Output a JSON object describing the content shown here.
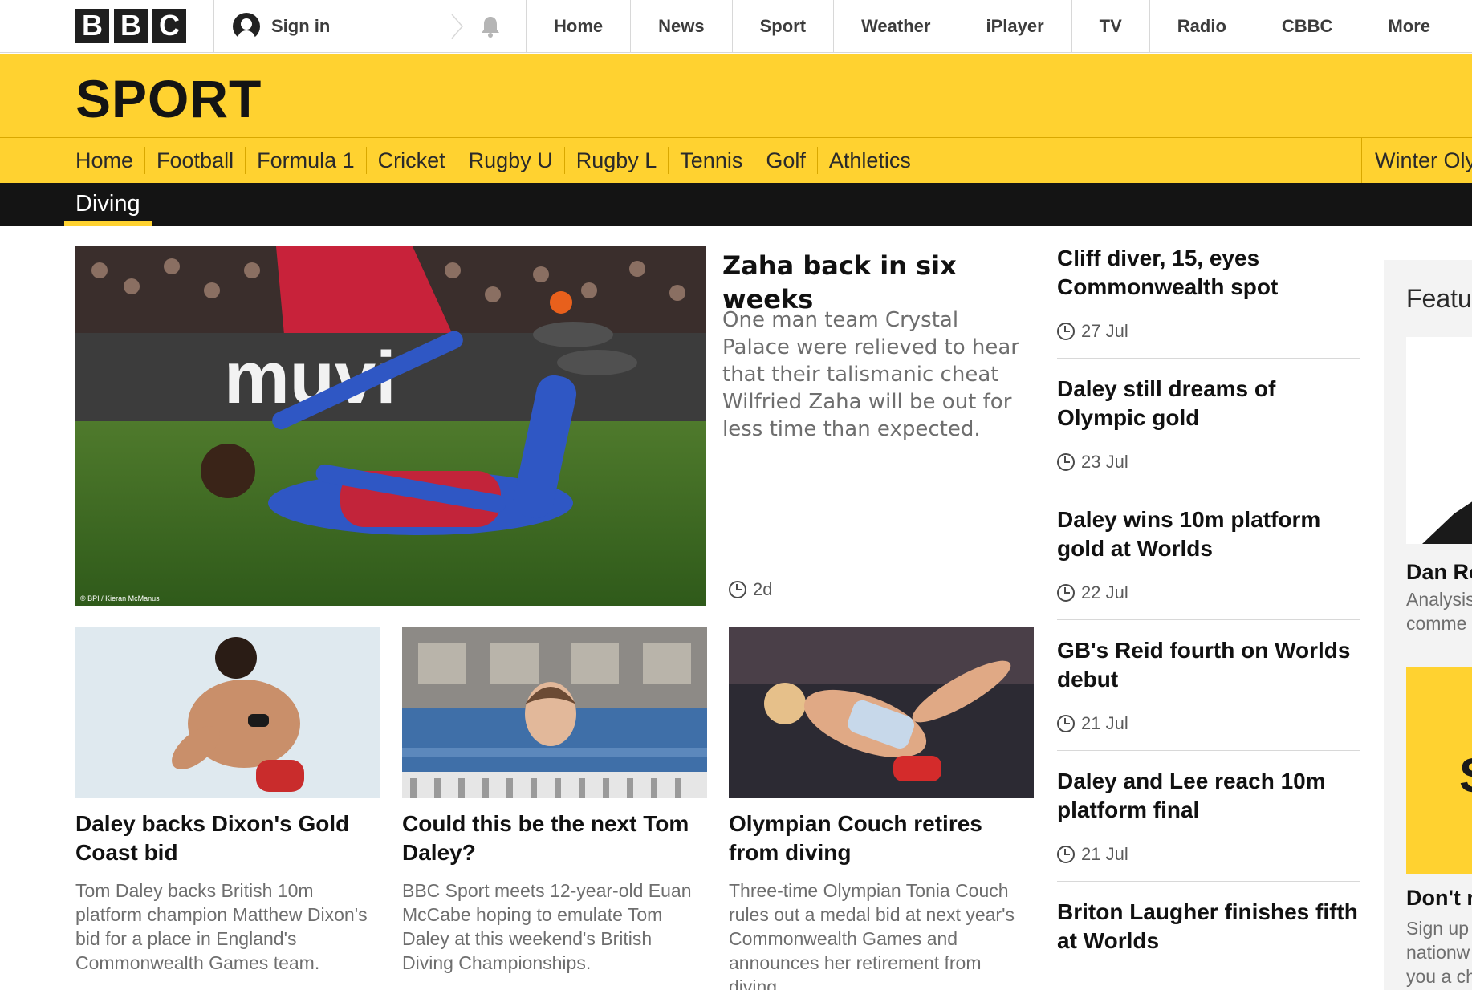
{
  "top_bar": {
    "logo_letters": [
      "B",
      "B",
      "C"
    ],
    "sign_in_label": "Sign in",
    "nav": [
      "Home",
      "News",
      "Sport",
      "Weather",
      "iPlayer",
      "TV",
      "Radio",
      "CBBC",
      "More"
    ]
  },
  "sport_header": {
    "title": "SPORT",
    "nav": [
      "Home",
      "Football",
      "Formula 1",
      "Cricket",
      "Rugby U",
      "Rugby L",
      "Tennis",
      "Golf",
      "Athletics"
    ],
    "overflow_item": "Winter Oly",
    "accent_color": "#ffd230"
  },
  "sub_nav": {
    "active_label": "Diving"
  },
  "lead_story": {
    "image_caption": "© BPI / Kieran McManus",
    "billboard_text": "muvi",
    "title": "Zaha back in six weeks",
    "summary": "One man team Crystal Palace were relieved to hear that their talismanic cheat Wilfried Zaha will be out for less time than expected.",
    "timestamp": "2d"
  },
  "cards": [
    {
      "title": "Daley backs Dixon's Gold Coast bid",
      "summary": "Tom Daley backs British 10m platform champion Matthew Dixon's bid for a place in England's Commonwealth Games team."
    },
    {
      "title": "Could this be the next Tom Daley?",
      "summary": "BBC Sport meets 12-year-old Euan McCabe hoping to emulate Tom Daley at this weekend's British Diving Championships."
    },
    {
      "title": "Olympian Couch retires from diving",
      "summary": "Three-time Olympian Tonia Couch rules out a medal bid at next year's Commonwealth Games and announces her retirement from diving."
    }
  ],
  "sidebar": [
    {
      "title": "Cliff diver, 15, eyes Commonwealth spot",
      "timestamp": "27 Jul"
    },
    {
      "title": "Daley still dreams of Olympic gold",
      "timestamp": "23 Jul"
    },
    {
      "title": "Daley wins 10m platform gold at Worlds",
      "timestamp": "22 Jul"
    },
    {
      "title": "GB's Reid fourth on Worlds debut",
      "timestamp": "21 Jul"
    },
    {
      "title": "Daley and Lee reach 10m platform final",
      "timestamp": "21 Jul"
    },
    {
      "title": "Briton Laugher finishes fifth at Worlds",
      "timestamp": ""
    }
  ],
  "featured": {
    "heading": "Featu",
    "item1_name": "Dan Ro",
    "item1_summary_lines": [
      "Analysis",
      "comme"
    ],
    "item2_letter": "S",
    "item2_name": "Don't m",
    "item2_summary_lines": [
      "Sign up",
      "nationw",
      "you a ch"
    ]
  }
}
